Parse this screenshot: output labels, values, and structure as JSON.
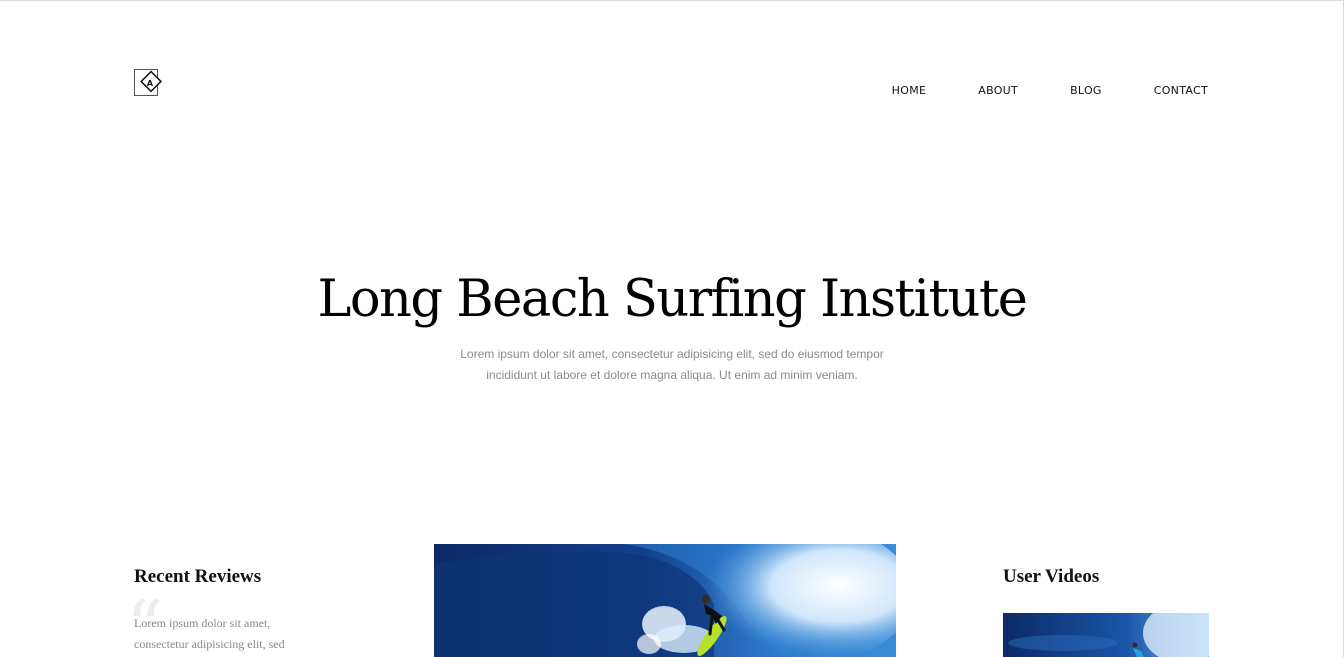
{
  "header": {
    "logo_letter": "A",
    "nav": [
      {
        "label": "HOME"
      },
      {
        "label": "ABOUT"
      },
      {
        "label": "BLOG"
      },
      {
        "label": "CONTACT"
      }
    ]
  },
  "hero": {
    "title": "Long Beach Surfing Institute",
    "subtitle": "Lorem ipsum dolor sit amet, consectetur adipisicing elit, sed do eiusmod tempor incididunt ut labore et dolore magna aliqua. Ut enim ad minim veniam."
  },
  "reviews": {
    "heading": "Recent Reviews",
    "quote_glyph": "“",
    "text": "Lorem ipsum dolor sit amet, consectetur adipisicing elit, sed"
  },
  "videos": {
    "heading": "User Videos"
  },
  "colors": {
    "text_dark": "#111111",
    "text_muted": "#8a8a8a",
    "ocean_deep": "#0d2f6e",
    "ocean_mid": "#1d5fb0",
    "surfboard": "#b6e02a"
  }
}
